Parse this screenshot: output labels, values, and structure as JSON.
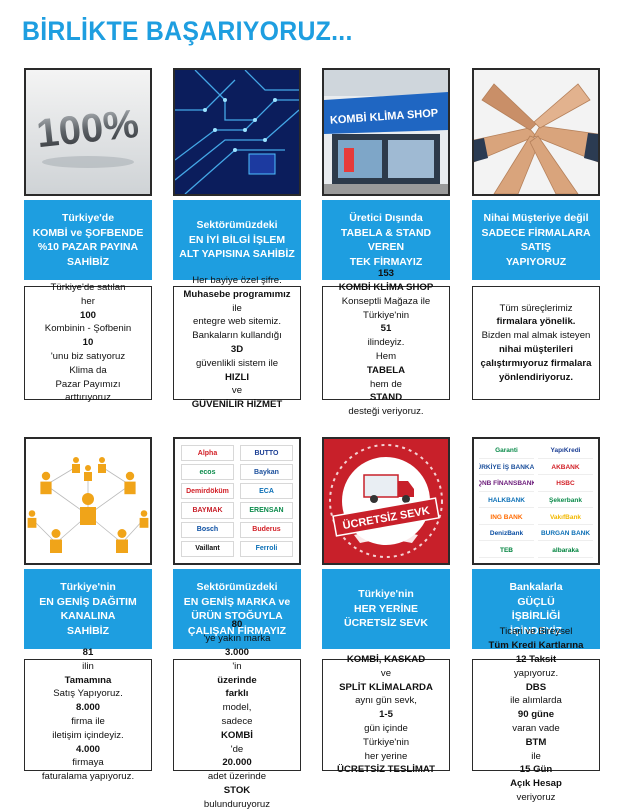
{
  "page": {
    "title": "BİRLİKTE BAŞARIYORUZ..."
  },
  "cards": [
    {
      "heading": [
        "Türkiye'de",
        "KOMBİ ve ŞOFBENDE",
        "%10 PAZAR PAYINA",
        "SAHİBİZ"
      ],
      "desc": [
        [
          {
            "t": "Türkiye'de satılan"
          }
        ],
        [
          {
            "t": "her "
          },
          {
            "t": "100",
            "b": true
          }
        ],
        [
          {
            "t": "Kombinin - Şofbenin"
          }
        ],
        [
          {
            "t": "10",
            "b": true
          },
          {
            "t": "'unu biz satıyoruz"
          }
        ],
        [
          {
            "t": "Klima da"
          }
        ],
        [
          {
            "t": "Pazar Payımızı"
          }
        ],
        [
          {
            "t": "arttırıyoruz"
          }
        ]
      ]
    },
    {
      "heading": [
        "Sektörümüzdeki",
        "EN İYİ BİLGİ İŞLEM",
        "ALT YAPISINA SAHİBİZ"
      ],
      "desc": [
        [
          {
            "t": "Her bayiye özel şifre."
          }
        ],
        [
          {
            "t": "Muhasebe programımız",
            "b": true
          },
          {
            "t": " ile"
          }
        ],
        [
          {
            "t": "entegre web sitemiz."
          }
        ],
        [
          {
            "t": "Bankaların kullandığı "
          },
          {
            "t": "3D",
            "b": true
          }
        ],
        [
          {
            "t": "güvenlikli sistem ile"
          }
        ],
        [
          {
            "t": "HIZLI",
            "b": true
          },
          {
            "t": " ve"
          }
        ],
        [
          {
            "t": "GÜVENİLİR HİZMET",
            "b": true
          }
        ]
      ]
    },
    {
      "heading": [
        "Üretici Dışında",
        "TABELA & STAND",
        "VEREN",
        "TEK FİRMAYIZ"
      ],
      "desc": [
        [
          {
            "t": "153",
            "b": true
          }
        ],
        [
          {
            "t": "KOMBİ KLİMA SHOP",
            "b": true
          }
        ],
        [
          {
            "t": "Konseptli Mağaza ile"
          }
        ],
        [
          {
            "t": "Türkiye'nin "
          },
          {
            "t": "51",
            "b": true
          },
          {
            "t": " ilindeyiz."
          }
        ],
        [
          {
            "t": "Hem "
          },
          {
            "t": "TABELA",
            "b": true
          }
        ],
        [
          {
            "t": "hem de "
          },
          {
            "t": "STAND",
            "b": true
          }
        ],
        [
          {
            "t": "desteği veriyoruz."
          }
        ]
      ]
    },
    {
      "heading": [
        "Nihai Müşteriye değil",
        "SADECE FİRMALARA",
        "SATIŞ",
        "YAPIYORUZ"
      ],
      "desc": [
        [
          {
            "t": "Tüm süreçlerimiz"
          }
        ],
        [
          {
            "t": "firmalara yönelik.",
            "b": true
          }
        ],
        [
          {
            "t": "Bizden mal almak isteyen"
          }
        ],
        [
          {
            "t": "nihai müşterileri",
            "b": true
          }
        ],
        [
          {
            "t": "çalıştırmıyoruz firmalara",
            "b": true
          }
        ],
        [
          {
            "t": "yönlendiriyoruz.",
            "b": true
          }
        ]
      ]
    },
    {
      "heading": [
        "Türkiye'nin",
        "EN GENİŞ DAĞITIM",
        "KANALINA",
        "SAHİBİZ"
      ],
      "desc": [
        [
          {
            "t": "81",
            "b": true
          },
          {
            "t": " ilin "
          },
          {
            "t": "Tamamına",
            "b": true
          }
        ],
        [
          {
            "t": "Satış Yapıyoruz."
          }
        ],
        [
          {
            "t": "8.000",
            "b": true
          },
          {
            "t": " firma ile"
          }
        ],
        [
          {
            "t": "iletişim içindeyiz."
          }
        ],
        [
          {
            "t": "4.000",
            "b": true
          },
          {
            "t": " firmaya"
          }
        ],
        [
          {
            "t": "faturalama yapıyoruz."
          }
        ]
      ]
    },
    {
      "heading": [
        "Sektörümüzdeki",
        "EN GENİŞ MARKA ve",
        "ÜRÜN STOĞUYLA",
        "ÇALIŞAN FİRMAYIZ"
      ],
      "desc": [
        [
          {
            "t": "80",
            "b": true
          },
          {
            "t": "'ye yakın marka"
          }
        ],
        [
          {
            "t": "3.000",
            "b": true
          },
          {
            "t": "'in "
          },
          {
            "t": "üzerinde",
            "b": true
          }
        ],
        [
          {
            "t": "farklı",
            "b": true
          },
          {
            "t": " model,"
          }
        ],
        [
          {
            "t": "sadece "
          },
          {
            "t": "KOMBİ",
            "b": true
          },
          {
            "t": "'de"
          }
        ],
        [
          {
            "t": "20.000",
            "b": true
          },
          {
            "t": " adet üzerinde"
          }
        ],
        [
          {
            "t": "STOK",
            "b": true
          }
        ],
        [
          {
            "t": "bulunduruyoruz"
          }
        ]
      ]
    },
    {
      "heading": [
        "Türkiye'nin",
        "HER YERİNE",
        "ÜCRETSİZ SEVK"
      ],
      "photo_label": "ÜCRETSİZ SEVK",
      "desc": [
        [
          {
            "t": "KOMBİ, KASKAD",
            "b": true
          }
        ],
        [
          {
            "t": "ve "
          },
          {
            "t": "SPLİT KLİMALARDA",
            "b": true
          }
        ],
        [
          {
            "t": "aynı gün sevk,"
          }
        ],
        [
          {
            "t": "1-5",
            "b": true
          },
          {
            "t": " gün içinde"
          }
        ],
        [
          {
            "t": "Türkiye'nin"
          }
        ],
        [
          {
            "t": "her yerine"
          }
        ],
        [
          {
            "t": "ÜCRETSİZ TESLİMAT",
            "b": true
          }
        ]
      ]
    },
    {
      "heading": [
        "Bankalarla",
        "GÜÇLÜ",
        "İŞBİRLİĞİ",
        "İÇİNDEYİZ"
      ],
      "desc": [
        [
          {
            "t": "Ticari ve Bireysel"
          }
        ],
        [
          {
            "t": "Tüm Kredi Kartlarına",
            "b": true
          }
        ],
        [
          {
            "t": "12 Taksit",
            "b": true
          },
          {
            "t": " yapıyoruz."
          }
        ],
        [
          {
            "t": "DBS",
            "b": true
          },
          {
            "t": " ile alımlarda"
          }
        ],
        [
          {
            "t": "90 güne",
            "b": true
          },
          {
            "t": " varan vade"
          }
        ],
        [
          {
            "t": "BTM",
            "b": true
          },
          {
            "t": " ile "
          },
          {
            "t": "15 Gün",
            "b": true
          }
        ],
        [
          {
            "t": "Açık Hesap",
            "b": true
          },
          {
            "t": " veriyoruz"
          }
        ]
      ]
    }
  ],
  "banks": [
    [
      "Garanti",
      "YapıKredi"
    ],
    [
      "TÜRKİYE İŞ BANKASI",
      "AKBANK"
    ],
    [
      "QNB FİNANSBANK",
      "HSBC"
    ],
    [
      "HALKBANK",
      "Şekerbank"
    ],
    [
      "ING BANK",
      "VakıfBank"
    ],
    [
      "DenizBank",
      "BURGAN BANK"
    ],
    [
      "TEB",
      "albaraka"
    ]
  ],
  "brands": [
    [
      "Alpha",
      "BUTTO"
    ],
    [
      "ecos",
      "Baykan"
    ],
    [
      "Demirdöküm",
      "ECA"
    ],
    [
      "BAYMAK",
      "ERENSAN"
    ],
    [
      "Bosch",
      "Buderus"
    ],
    [
      "Vaillant",
      "Ferroli"
    ]
  ],
  "store_sign": "KOMBİ KLİMA SHOP",
  "colors": {
    "accent": "#1e9ee0",
    "border": "#2a2a2a"
  }
}
